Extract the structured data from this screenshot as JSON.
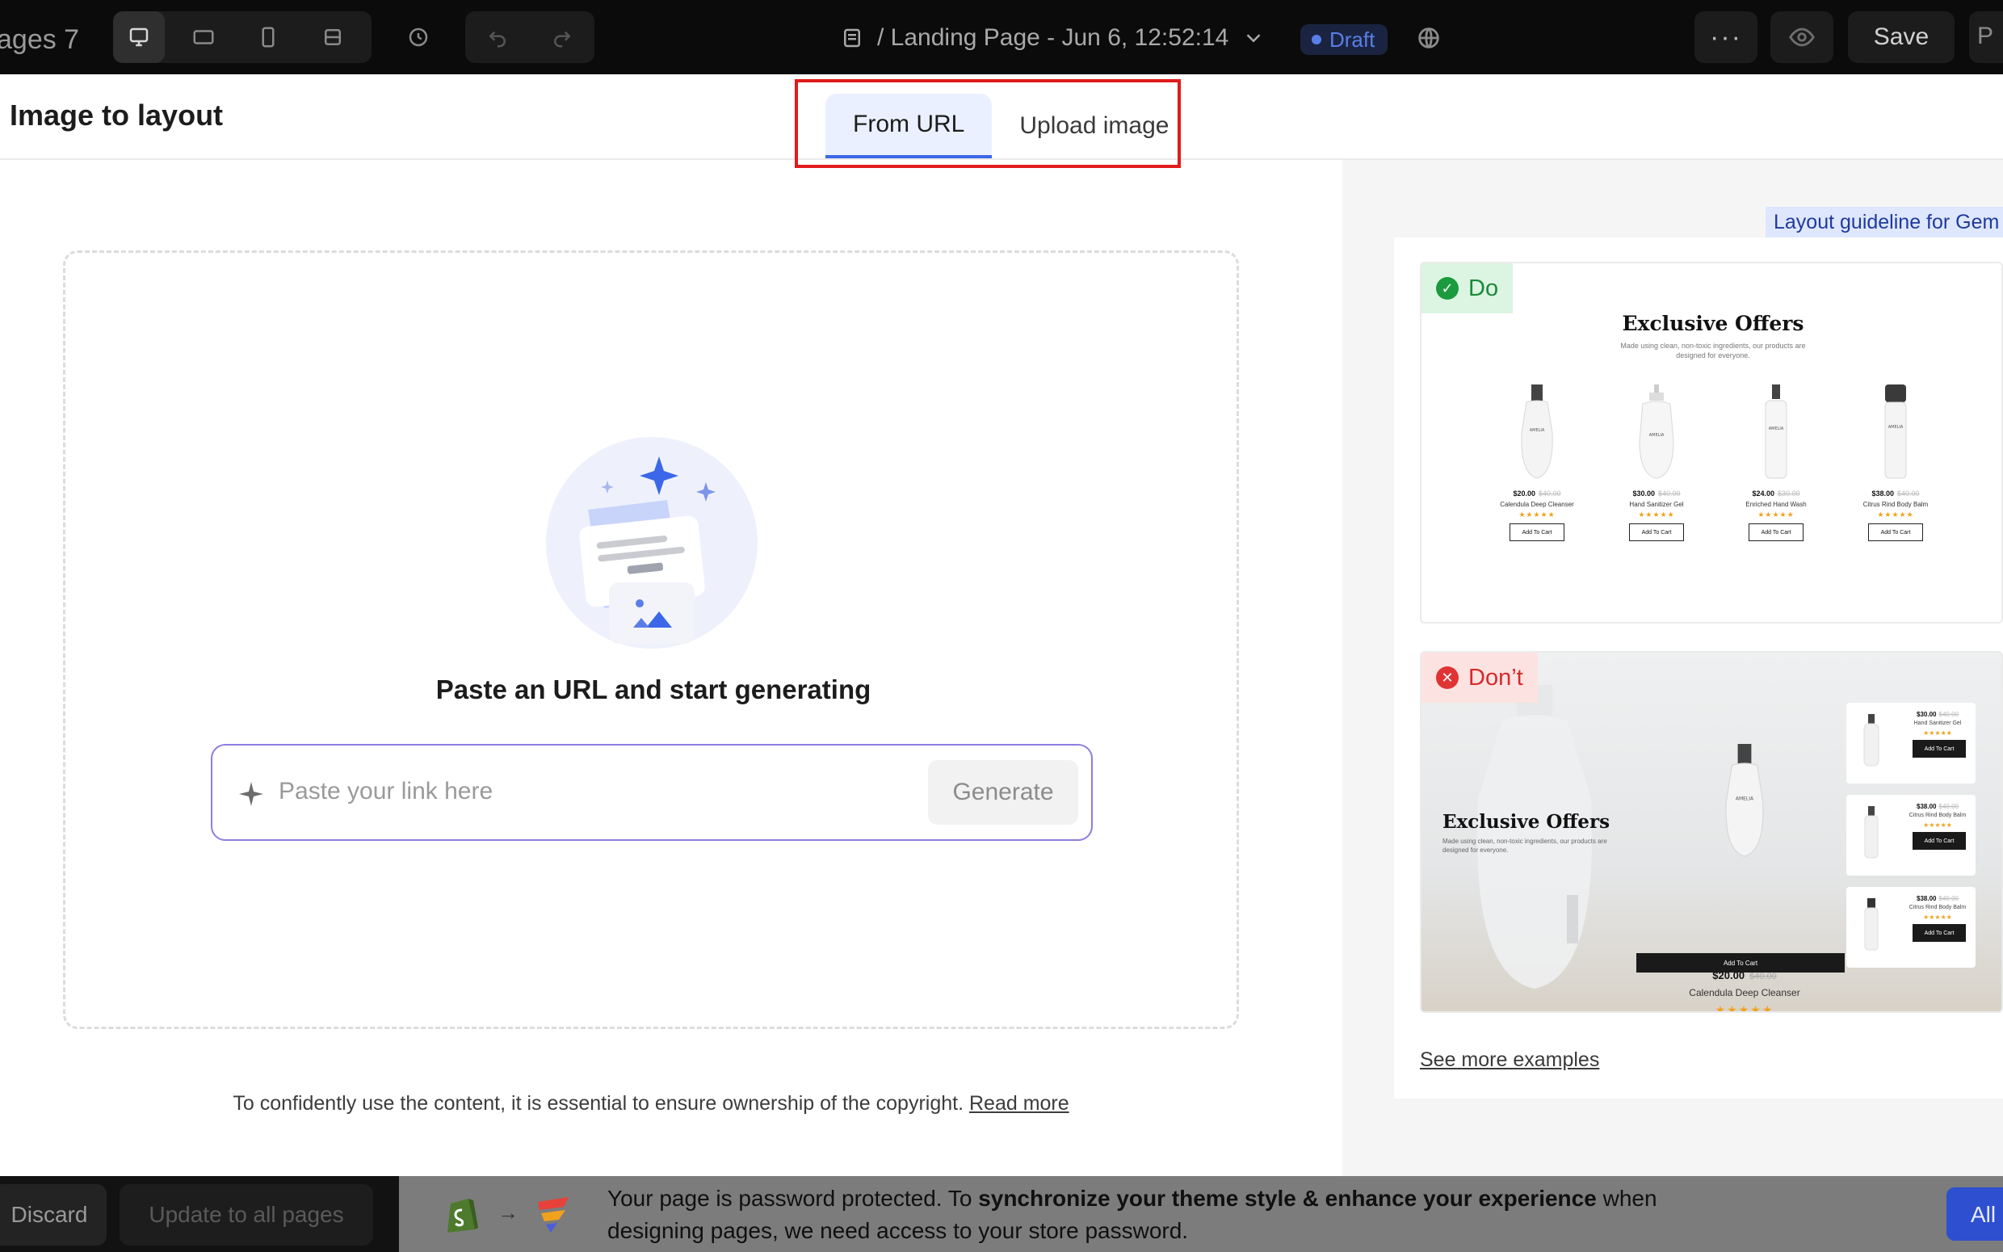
{
  "topbar": {
    "app_name": "ages 7",
    "page_crumb": "/ Landing Page - Jun 6, 12:52:14",
    "draft_label": "Draft",
    "more_label": "···",
    "save_label": "Save",
    "publish_partial": "P"
  },
  "modal": {
    "title": "Image to layout",
    "tabs": [
      {
        "label": "From URL",
        "active": true
      },
      {
        "label": "Upload image",
        "active": false
      }
    ],
    "left": {
      "heading": "Paste an URL and start generating",
      "input_placeholder": "Paste your link here",
      "generate_label": "Generate",
      "copyright_text": "To confidently use the content, it is essential to ensure ownership of the copyright.",
      "read_more_label": "Read more"
    },
    "right": {
      "guideline_label": "Layout guideline for Gem",
      "do_label": "Do",
      "dont_label": "Don’t",
      "see_more_label": "See more examples",
      "do_example": {
        "title": "Exclusive Offers",
        "subtitle": "Made using clean, non-toxic ingredients, our products are designed for everyone.",
        "products": [
          {
            "price": "$20.00",
            "old_price": "$40.00",
            "name": "Calendula Deep Cleanser",
            "stars": "★★★★★",
            "button": "Add To Cart"
          },
          {
            "price": "$30.00",
            "old_price": "$40.00",
            "name": "Hand Sanitizer Gel",
            "stars": "★★★★★",
            "button": "Add To Cart"
          },
          {
            "price": "$24.00",
            "old_price": "$30.00",
            "name": "Enriched Hand Wash",
            "stars": "★★★★★",
            "button": "Add To Cart"
          },
          {
            "price": "$38.00",
            "old_price": "$40.00",
            "name": "Citrus Rind Body Balm",
            "stars": "★★★★★",
            "button": "Add To Cart"
          }
        ]
      },
      "dont_example": {
        "title": "Exclusive Offers",
        "subtitle": "Made using clean, non-toxic ingredients, our products are designed for everyone.",
        "main_price": "$20.00",
        "main_old_price": "$40.00",
        "main_name": "Calendula Deep Cleanser",
        "main_stars": "★★★★★",
        "main_button": "Add To Cart",
        "side_cards": [
          {
            "price": "$30.00",
            "old_price": "$40.00",
            "name": "Hand Sanitizer Gel",
            "stars": "★★★★★",
            "button": "Add To Cart"
          },
          {
            "price": "$38.00",
            "old_price": "$40.00",
            "name": "Citrus Rind Body Balm",
            "stars": "★★★★★",
            "button": "Add To Cart"
          },
          {
            "price": "$38.00",
            "old_price": "$40.00",
            "name": "Citrus Rind Body Balm",
            "stars": "★★★★★",
            "button": "Add To Cart"
          }
        ]
      },
      "bottle_label": "AMELIA"
    }
  },
  "bottombar": {
    "discard_label": "Discard",
    "update_label": "Update to all pages",
    "notice_prefix": "Your page is password protected. To ",
    "notice_bold": "synchronize your theme style & enhance your experience",
    "notice_suffix": " when designing pages, we need access to your store password.",
    "arrow": "→",
    "allow_partial": "All"
  },
  "colors": {
    "accent": "#3c67e8",
    "highlight": "#e11b1b",
    "do_green": "#1b9a3e",
    "dont_red": "#e03333",
    "input_border": "#8f7de0"
  }
}
